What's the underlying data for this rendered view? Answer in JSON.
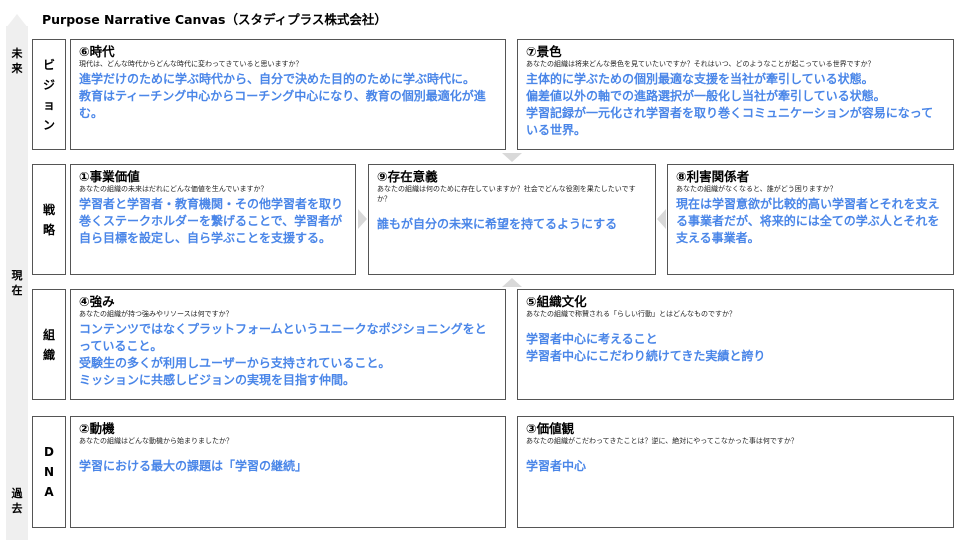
{
  "title": "Purpose Narrative Canvas（スタディプラス株式会社）",
  "time_axis": {
    "future": "未\n来",
    "present": "現\n在",
    "past": "過\n去"
  },
  "rows": {
    "vision": "ビ\nジ\nョ\nン",
    "strategy": "戦\n略",
    "organization": "組\n織",
    "dna": "D\nN\nA"
  },
  "cells": {
    "era": {
      "title": "⑥時代",
      "question": "現代は、どんな時代からどんな時代に変わってきていると思いますか？",
      "answer": [
        "進学だけのために学ぶ時代から、自分で決めた目的のために学ぶ時代に。",
        "教育はティーチング中心からコーチング中心になり、教育の個別最適化が進む。"
      ]
    },
    "scenery": {
      "title": "⑦景色",
      "question": "あなたの組織は将来どんな景色を見ていたいですか？それはいつ、どのようなことが起こっている世界ですか？",
      "answer": [
        "主体的に学ぶための個別最適な支援を当社が牽引している状態。",
        "偏差値以外の軸での進路選択が一般化し当社が牽引している状態。",
        "学習記録が一元化され学習者を取り巻くコミュニケーションが容易になっている世界。"
      ]
    },
    "business_value": {
      "title": "①事業価値",
      "question": "あなたの組織の未来はだれにどんな価値を生んでいますか？",
      "answer": [
        "学習者と学習者・教育機関・その他学習者を取り巻くステークホルダーを繋げることで、学習者が自ら目標を設定し、自ら学ぶことを支援する。"
      ]
    },
    "purpose": {
      "title": "⑨存在意義",
      "question": "あなたの組織は何のために存在していますか？社会でどんな役割を果たしたいですか？",
      "answer": [
        "誰もが自分の未来に希望を持てるようにする"
      ]
    },
    "stakeholders": {
      "title": "⑧利害関係者",
      "question": "あなたの組織がなくなると、誰がどう困りますか？",
      "answer": [
        "現在は学習意欲が比較的高い学習者とそれを支える事業者だが、将来的には全ての学ぶ人とそれを支える事業者。"
      ]
    },
    "strengths": {
      "title": "④強み",
      "question": "あなたの組織が持つ強みやリソースは何ですか？",
      "answer": [
        "コンテンツではなくプラットフォームというユニークなポジショニングをとっていること。",
        "受験生の多くが利用しユーザーから支持されていること。",
        "ミッションに共感しビジョンの実現を目指す仲間。"
      ]
    },
    "culture": {
      "title": "⑤組織文化",
      "question": "あなたの組織で称賛される「らしい行動」とはどんなものですか？",
      "answer": [
        "学習者中心に考えること",
        "学習者中心にこだわり続けてきた実績と誇り"
      ]
    },
    "motive": {
      "title": "②動機",
      "question": "あなたの組織はどんな動機から始まりましたか？",
      "answer": [
        "学習における最大の課題は「学習の継続」"
      ]
    },
    "values": {
      "title": "③価値観",
      "question": "あなたの組織がこだわってきたことは？逆に、絶対にやってこなかった事は何ですか？",
      "answer": [
        "学習者中心"
      ]
    }
  }
}
